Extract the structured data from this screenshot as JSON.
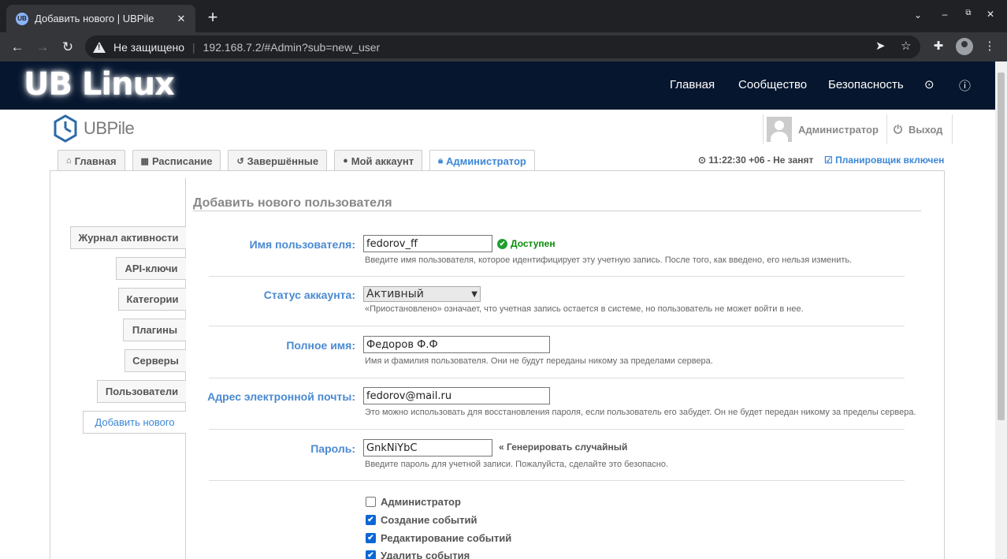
{
  "browser": {
    "tab_title": "Добавить нового | UBPile",
    "favicon": "UB",
    "security_label": "Не защищено",
    "url": "192.168.7.2/#Admin?sub=new_user"
  },
  "site": {
    "brand": "UB Linux",
    "nav": [
      "Главная",
      "Сообщество",
      "Безопасность"
    ]
  },
  "app": {
    "logo_text": "UBPile",
    "user_name": "Администратор",
    "logout_label": "Выход",
    "tabs": [
      {
        "label": "Главная",
        "icon": "home-icon"
      },
      {
        "label": "Расписание",
        "icon": "calendar-icon"
      },
      {
        "label": "Завершённые",
        "icon": "history-icon"
      },
      {
        "label": "Мой аккаунт",
        "icon": "user-icon"
      },
      {
        "label": "Администратор",
        "icon": "lock-icon",
        "active": true
      }
    ],
    "clock": "11:22:30 +06 - Не занят",
    "scheduler": "Планировщик включен"
  },
  "sidebar": {
    "items": [
      "Журнал активности",
      "API-ключи",
      "Категории",
      "Плагины",
      "Серверы",
      "Пользователи",
      "Добавить нового"
    ],
    "active_index": 6
  },
  "form": {
    "title": "Добавить нового пользователя",
    "username": {
      "label": "Имя пользователя:",
      "value": "fedorov_ff",
      "status": "Доступен",
      "hint": "Введите имя пользователя, которое идентифицирует эту учетную запись. После того, как введено, его нельзя изменить."
    },
    "status": {
      "label": "Статус аккаунта:",
      "value": "Активный",
      "hint": "«Приостановлено» означает, что учетная запись остается в системе, но пользователь не может войти в нее."
    },
    "fullname": {
      "label": "Полное имя:",
      "value": "Федоров Ф.Ф",
      "hint": "Имя и фамилия пользователя. Они не будут переданы никому за пределами сервера."
    },
    "email": {
      "label": "Адрес электронной почты:",
      "value": "fedorov@mail.ru",
      "hint": "Это можно использовать для восстановления пароля, если пользователь его забудет. Он не будет передан никому за пределы сервера."
    },
    "password": {
      "label": "Пароль:",
      "value": "GnkNiYbC",
      "generate": "« Генерировать случайный",
      "hint": "Введите пароль для учетной записи. Пожалуйста, сделайте это безопасно."
    },
    "privileges": [
      {
        "label": "Администратор",
        "checked": false
      },
      {
        "label": "Создание событий",
        "checked": true
      },
      {
        "label": "Редактирование событий",
        "checked": true
      },
      {
        "label": "Удалить события",
        "checked": true
      }
    ]
  }
}
